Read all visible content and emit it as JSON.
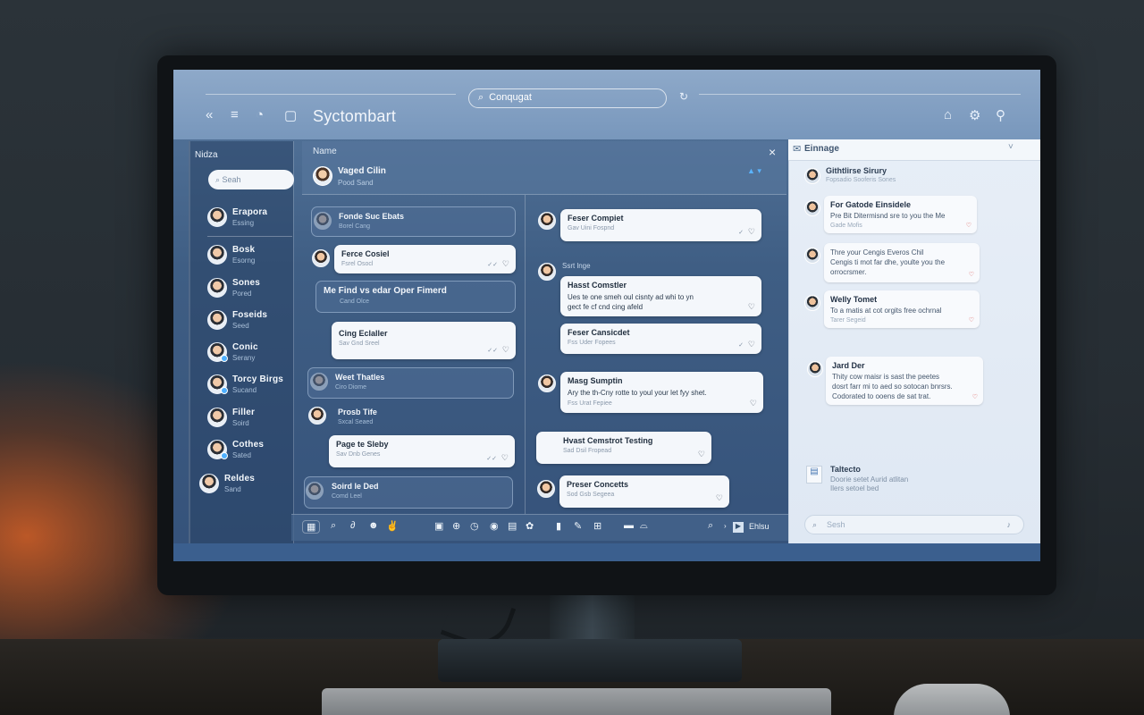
{
  "app": {
    "title": "Syctombart"
  },
  "topbar": {
    "search_value": "Conqugat",
    "icons": [
      "double-chevron-left-icon",
      "menu-icon",
      "history-icon",
      "clipboard-icon",
      "refresh-icon",
      "lock-icon",
      "settings-icon",
      "user-icon"
    ]
  },
  "sidebar": {
    "title": "Nidza",
    "search_placeholder": "Seah",
    "items": [
      {
        "name": "Erapora",
        "status": "Essing"
      },
      {
        "name": "Bosk",
        "status": "Esorng"
      },
      {
        "name": "Sones",
        "status": "Pored"
      },
      {
        "name": "Foseids",
        "status": "Seed"
      },
      {
        "name": "Conic",
        "status": "Serany"
      },
      {
        "name": "Torcy Birgs",
        "status": "Sucand"
      },
      {
        "name": "Filler",
        "status": "Soird"
      },
      {
        "name": "Cothes",
        "status": "Sated"
      },
      {
        "name": "Reldes",
        "status": "Sand"
      }
    ]
  },
  "conversation": {
    "label": "Name",
    "contact_name": "Vaged Cilin",
    "contact_status": "Pood Sand"
  },
  "left_messages": [
    {
      "title": "Fonde Suc Ebats",
      "sub": "Borel Cang"
    },
    {
      "title": "Ferce Cosiel",
      "sub": "Fsrel Osocl"
    },
    {
      "title": "Me Find vs edar Oper Fimerd",
      "sub": "Cand Olce"
    },
    {
      "title": "Cing Eclaller",
      "sub": "Sav Gnd Sreel"
    },
    {
      "title": "Weet Thatles",
      "sub": "Ciro Diome"
    },
    {
      "title": "Prosb Tife",
      "sub": "Sxcal Seaed"
    },
    {
      "title": "Page te Sleby",
      "sub": "Sav Dnb Genes"
    },
    {
      "title": "Soird le Ded",
      "sub": "Comd Leel"
    }
  ],
  "mid_messages": [
    {
      "title": "Feser Compiet",
      "sub": "Gav Uini Fospnd"
    },
    {
      "label": "Ssrt lnge",
      "title": "Hasst Comstler",
      "body1": "Ues te one smeh oul cisnty ad whi to yn",
      "body2": "gect fe cf cnd cing afeld"
    },
    {
      "title": "Feser Cansicdet",
      "sub": "Fss Uder Fopees"
    },
    {
      "title": "Masg Sumptin",
      "body1": "Ary the th-Cny rotte to youl your let fyy shet.",
      "sub": "Fss Urat Fepiee"
    },
    {
      "title": "Hvast Cemstrot Testing",
      "sub": "Sad Dsil Fropead"
    },
    {
      "title": "Preser Concetts",
      "sub": "Sod Gsb Segeea"
    }
  ],
  "right_panel": {
    "header": "Einnage",
    "top_item": {
      "title": "Githtlirse Sirury",
      "sub": "Fopsadio Sooferis Sones"
    },
    "items": [
      {
        "title": "For Gatode Einsidele",
        "body": "Pre Bit Ditermisnd sre to you the Me",
        "sub": "Gade Mofis"
      },
      {
        "title": "",
        "body": "Thre your Cengis Everos Chil",
        "body2": "Cengis ti mot far dhe, youlte you the",
        "sub": "orrocrsmer."
      },
      {
        "title": "Welly Tomet",
        "body": "To a matis at cot orgits free ochrnal",
        "sub": "Tarer Segeid"
      },
      {
        "title": "Jard Der",
        "body": "Thity cow maisr is sast the peetes",
        "body2": "dosrt farr mi to aed so sotocan bnrsrs.",
        "body3": "Codorated to ooens de sat trat."
      }
    ],
    "bottom_item": {
      "title": "Taltecto",
      "body": "Doorie setet Aurid atlitan",
      "sub": "Ilers setoel bed"
    },
    "search_placeholder": "Sesh"
  },
  "toolbar": {
    "tail_label": "Ehlsu"
  },
  "colors": {
    "accent": "#4fb0ff",
    "topbar": "#7897bc",
    "panel": "#3f5e84",
    "right_panel": "#e7eef7"
  }
}
